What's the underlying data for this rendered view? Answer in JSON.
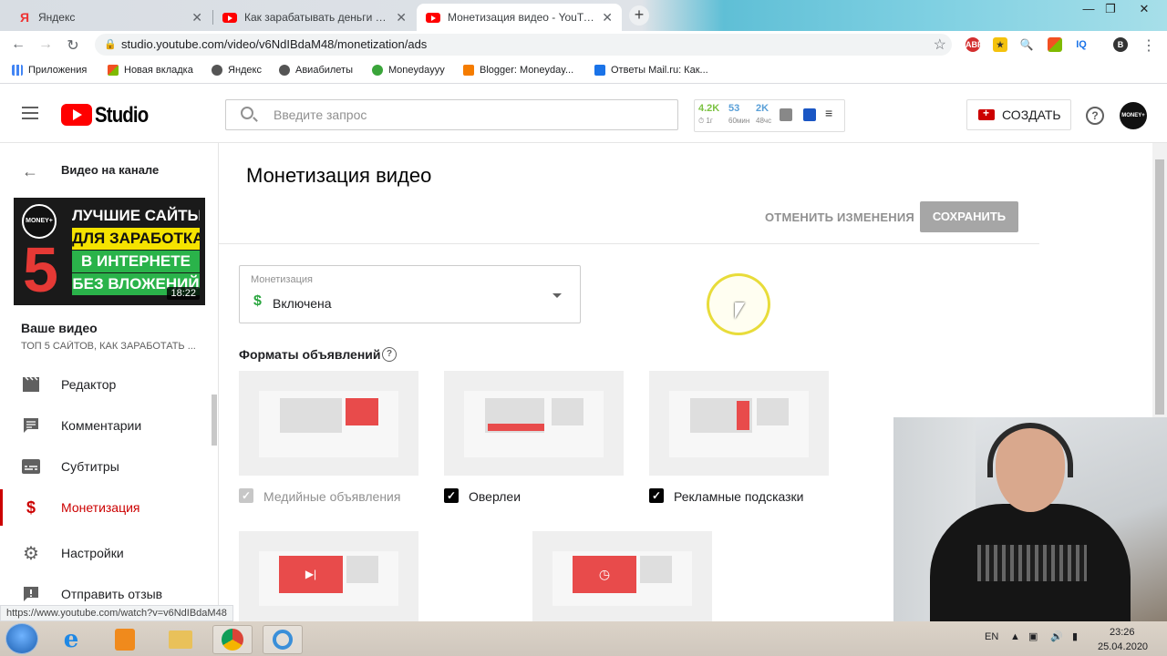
{
  "browser": {
    "tabs": [
      {
        "title": "Яндекс",
        "favicon": "yandex-icon",
        "active": false
      },
      {
        "title": "Как зарабатывать деньги в инте",
        "favicon": "youtube-icon",
        "active": false
      },
      {
        "title": "Монетизация видео - YouTube",
        "favicon": "youtube-icon",
        "active": true
      }
    ],
    "new_tab": "+",
    "address": "studio.youtube.com/video/v6NdIBdaM48/monetization/ads",
    "status_url": "https://www.youtube.com/watch?v=v6NdIBdaM48",
    "bookmarks": [
      {
        "label": "Приложения",
        "icon": "apps-grid-icon"
      },
      {
        "label": "Новая вкладка",
        "icon": "windows-tile-icon"
      },
      {
        "label": "Яндекс",
        "icon": "globe-icon"
      },
      {
        "label": "Авиабилеты",
        "icon": "globe-icon"
      },
      {
        "label": "Moneydayyy",
        "icon": "money-bag-icon"
      },
      {
        "label": "Blogger: Moneyday...",
        "icon": "blogger-icon"
      },
      {
        "label": "Ответы Mail.ru: Как...",
        "icon": "question-icon"
      }
    ],
    "extensions": [
      "ABP",
      "IQ"
    ]
  },
  "studio": {
    "logo_text": "Studio",
    "search_placeholder": "Введите запрос",
    "stats": [
      {
        "value": "4.2K",
        "sub": "1г",
        "color": "#7cc242"
      },
      {
        "value": "53",
        "sub": "60мин",
        "color": "#5aa0d8"
      },
      {
        "value": "2K",
        "sub": "48чс",
        "color": "#5aa0d8"
      }
    ],
    "create_label": "СОЗДАТЬ",
    "help_label": "?",
    "avatar_text": "MONEY+"
  },
  "sidebar": {
    "back_label": "Видео на канале",
    "thumbnail": {
      "lines": [
        "ЛУЧШИЕ САЙТЫ",
        "ДЛЯ ЗАРАБОТКА",
        "В ИНТЕРНЕТЕ",
        "БЕЗ ВЛОЖЕНИЙ"
      ],
      "number": "5",
      "badge": "MONEY+",
      "duration": "18:22"
    },
    "your_video": "Ваше видео",
    "video_title": "ТОП 5 САЙТОВ, КАК ЗАРАБОТАТЬ ...",
    "items": [
      {
        "label": "Редактор",
        "icon": "film-icon"
      },
      {
        "label": "Комментарии",
        "icon": "comment-icon"
      },
      {
        "label": "Субтитры",
        "icon": "subtitles-icon"
      },
      {
        "label": "Монетизация",
        "icon": "dollar-icon",
        "active": true
      },
      {
        "label": "Настройки",
        "icon": "gear-icon"
      },
      {
        "label": "Отправить отзыв",
        "icon": "feedback-icon"
      }
    ]
  },
  "main": {
    "title": "Монетизация видео",
    "discard_label": "ОТМЕНИТЬ ИЗМЕНЕНИЯ",
    "save_label": "СОХРАНИТЬ",
    "monetization": {
      "label": "Монетизация",
      "value": "Включена"
    },
    "formats_label": "Форматы объявлений",
    "formats": [
      {
        "label": "Медийные объявления",
        "checked": true,
        "disabled": true
      },
      {
        "label": "Оверлеи",
        "checked": true,
        "disabled": false
      },
      {
        "label": "Рекламные подсказки",
        "checked": true,
        "disabled": false
      }
    ]
  },
  "taskbar": {
    "lang": "EN",
    "time": "23:26",
    "date": "25.04.2020"
  }
}
